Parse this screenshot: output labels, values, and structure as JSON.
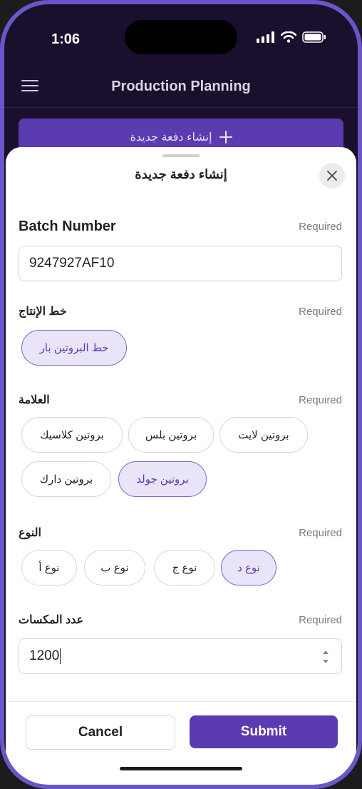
{
  "status_bar": {
    "time": "1:06"
  },
  "app_header": {
    "title": "Production Planning"
  },
  "create_batch_button": {
    "label": "إنشاء دفعة جديدة"
  },
  "sheet": {
    "title": "إنشاء دفعة جديدة",
    "batch_number": {
      "label": "Batch Number",
      "required": "Required",
      "value": "9247927AF10"
    },
    "production_line": {
      "label": "خط الإنتاج",
      "required": "Required",
      "options": [
        "خط البروتين بار"
      ],
      "selected": 0
    },
    "brand": {
      "label": "العلامة",
      "required": "Required",
      "options": [
        "بروتين لايت",
        "بروتين بلس",
        "بروتين كلاسيك",
        "بروتين جولد",
        "بروتين دارك"
      ],
      "selected": 3
    },
    "type": {
      "label": "النوع",
      "required": "Required",
      "options": [
        "نوع د",
        "نوع ج",
        "نوع ب",
        "نوع أ"
      ],
      "selected": 0
    },
    "box_count": {
      "label": "عدد المكسات",
      "required": "Required",
      "value": "1200"
    }
  },
  "footer": {
    "cancel_label": "Cancel",
    "submit_label": "Submit"
  },
  "colors": {
    "accent": "#5a3bb0",
    "chip_selected_bg": "#e9e4f8",
    "frame": "#6a56c8"
  }
}
